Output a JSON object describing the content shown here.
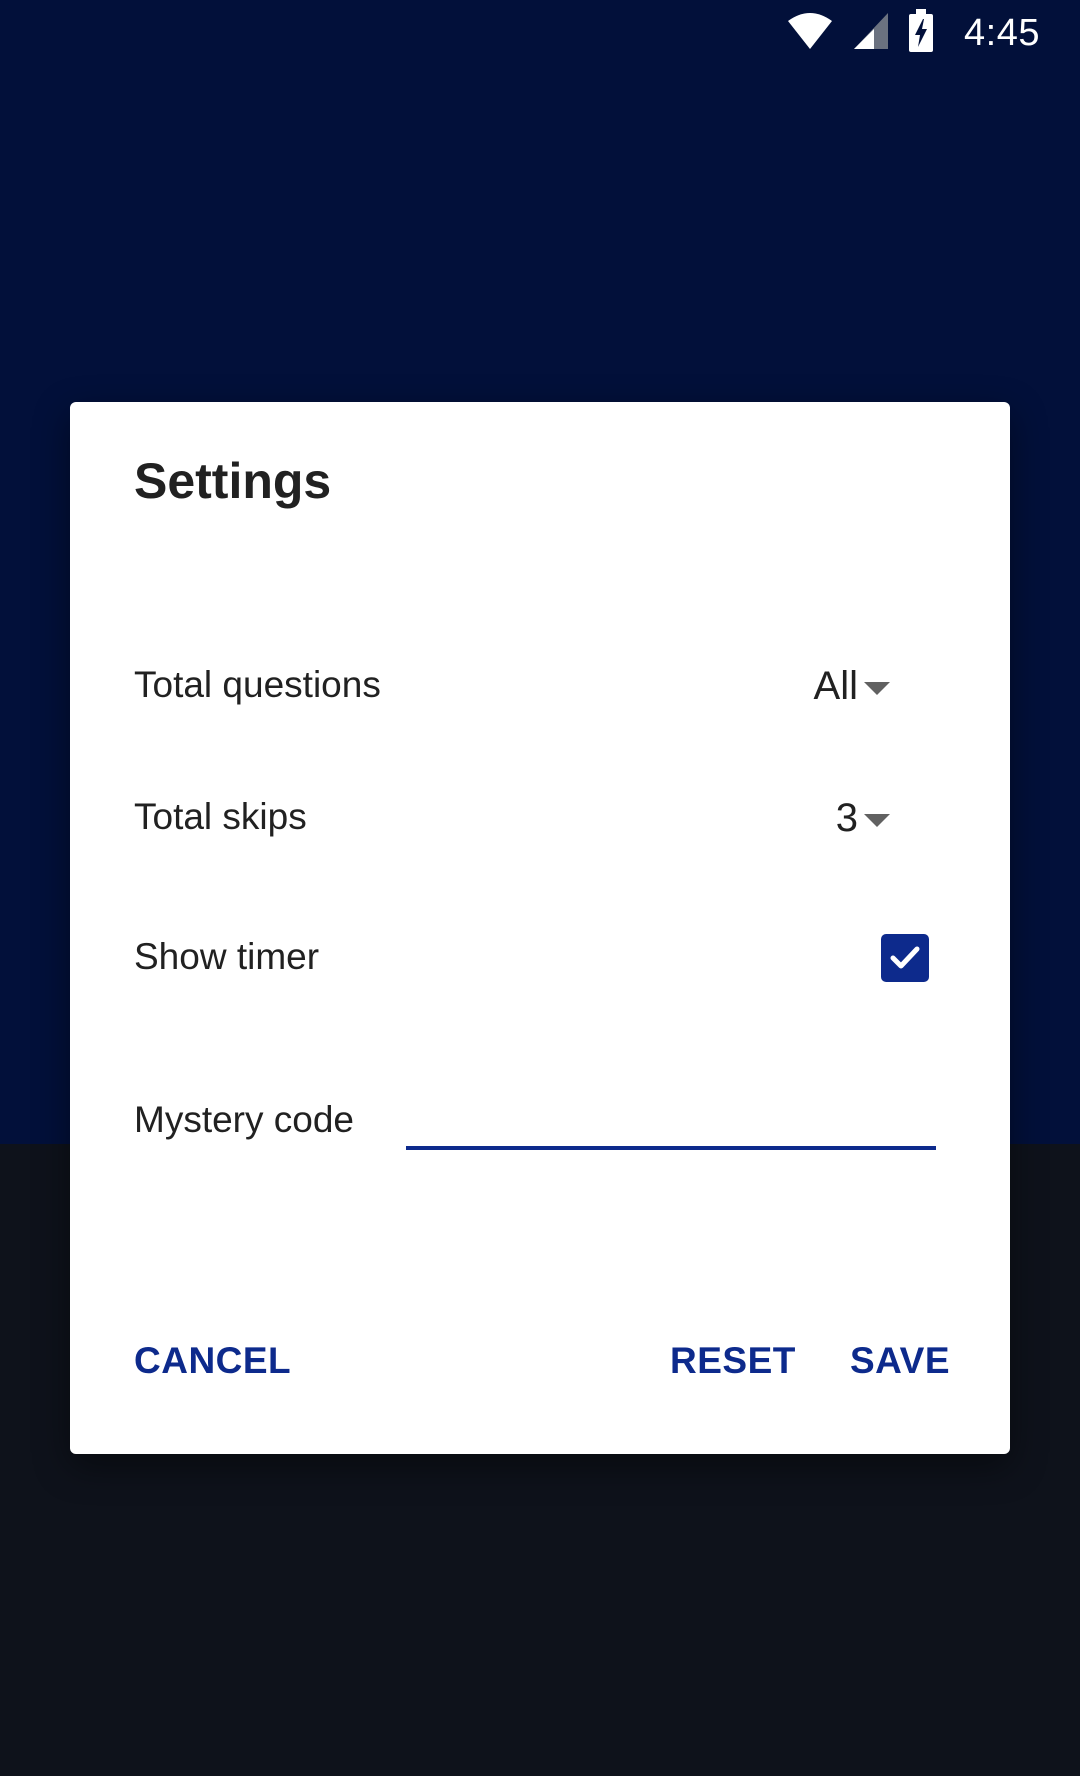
{
  "status_bar": {
    "time": "4:45",
    "icons": [
      "wifi-icon",
      "cell-signal-icon",
      "battery-charging-icon"
    ]
  },
  "dialog": {
    "title": "Settings",
    "total_questions": {
      "label": "Total questions",
      "value": "All"
    },
    "total_skips": {
      "label": "Total skips",
      "value": "3"
    },
    "show_timer": {
      "label": "Show timer",
      "checked": true
    },
    "mystery_code": {
      "label": "Mystery code",
      "value": ""
    },
    "buttons": {
      "cancel": "CANCEL",
      "reset": "RESET",
      "save": "SAVE"
    }
  },
  "colors": {
    "accent": "#0d2a8c",
    "background_top": "#02103a",
    "background_bottom": "#0e121b"
  }
}
